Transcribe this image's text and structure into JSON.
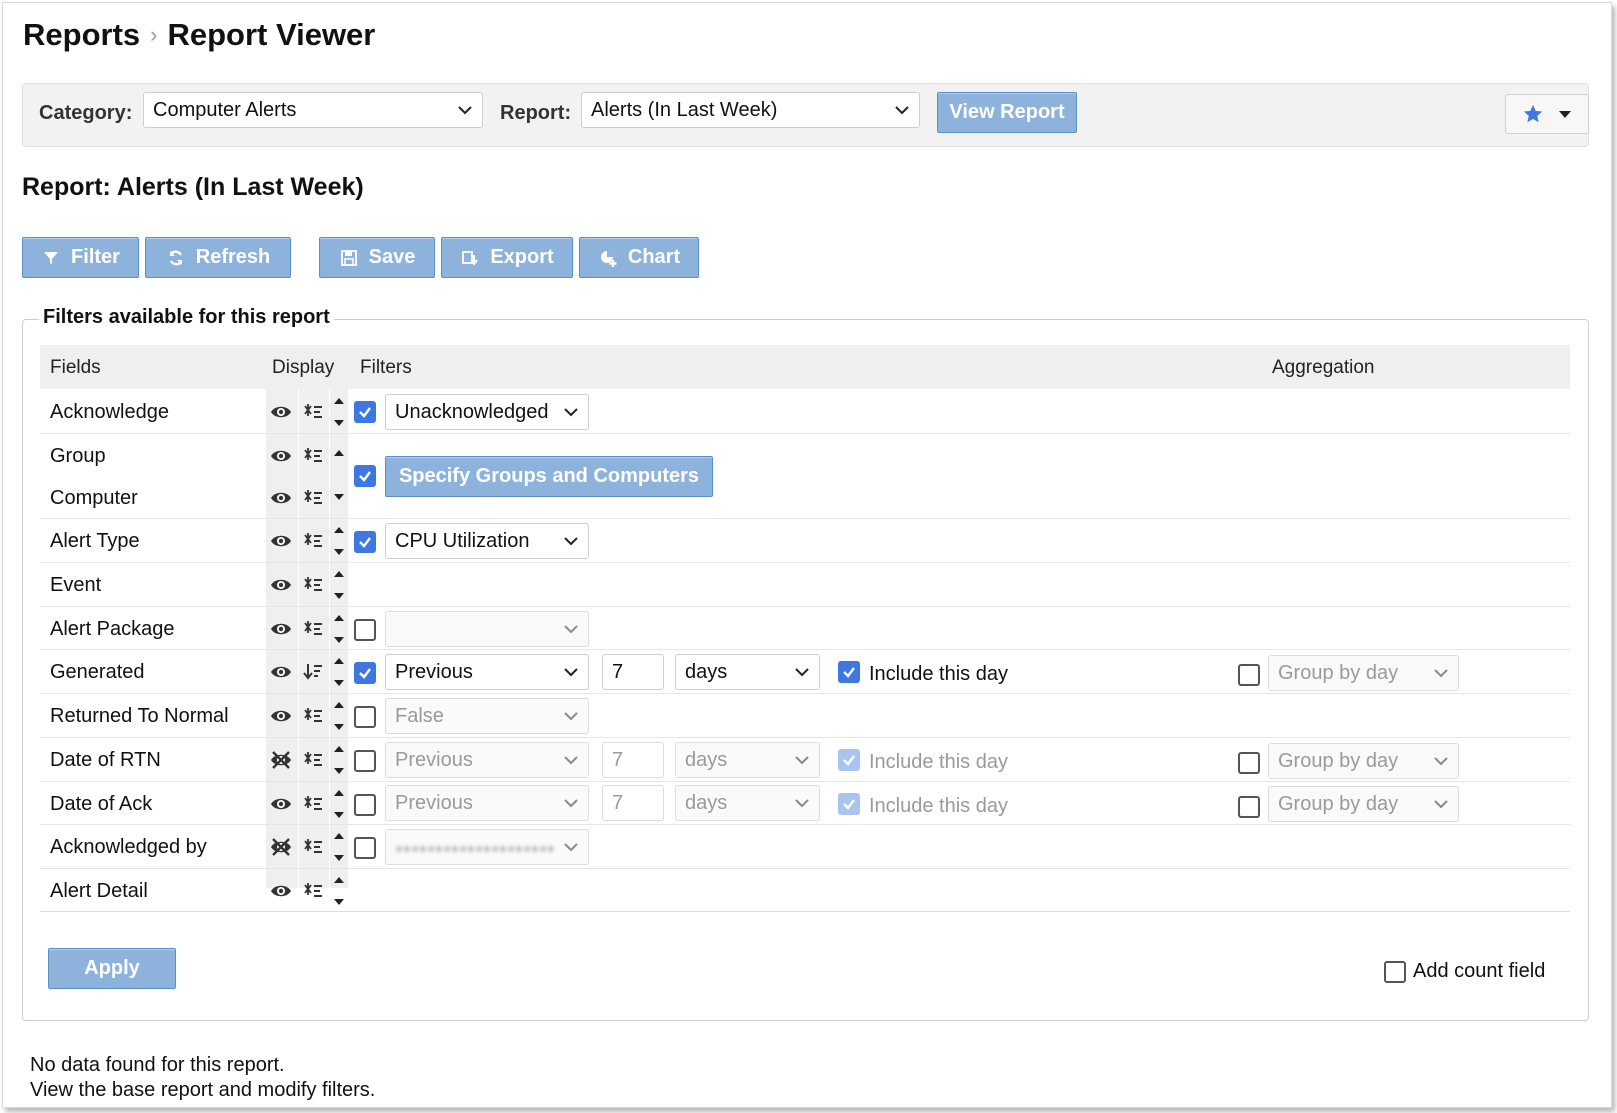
{
  "breadcrumb": {
    "parent": "Reports",
    "separator": "›",
    "current": "Report Viewer"
  },
  "toolbar": {
    "category_label": "Category:",
    "category_value": "Computer Alerts",
    "report_label": "Report:",
    "report_value": "Alerts (In Last Week)",
    "view_report_label": "View Report",
    "favorite_icon": "star-icon",
    "accent_color": "#8db3dd"
  },
  "report": {
    "title": "Report: Alerts (In Last Week)",
    "actions": {
      "filter": "Filter",
      "refresh": "Refresh",
      "save": "Save",
      "export": "Export",
      "chart": "Chart"
    }
  },
  "filters_panel": {
    "legend": "Filters available for this report",
    "columns": {
      "fields": "Fields",
      "display": "Display",
      "filters": "Filters",
      "aggregation": "Aggregation"
    },
    "rows": [
      {
        "field": "Acknowledge",
        "visible": true,
        "filter_enabled": true,
        "filter_value": "Unacknowledged"
      },
      {
        "field": "Group",
        "visible": true
      },
      {
        "field": "Computer",
        "visible": true,
        "filter_enabled": true,
        "filter_button": "Specify Groups and Computers"
      },
      {
        "field": "Alert Type",
        "visible": true,
        "filter_enabled": true,
        "filter_value": "CPU Utilization"
      },
      {
        "field": "Event",
        "visible": true
      },
      {
        "field": "Alert Package",
        "visible": true,
        "filter_enabled": false,
        "filter_value": ""
      },
      {
        "field": "Generated",
        "visible": true,
        "filter_enabled": true,
        "range": "Previous",
        "amount": "7",
        "unit": "days",
        "include_day": true,
        "include_label": "Include this day",
        "aggregate": false,
        "aggregation": "Group by day"
      },
      {
        "field": "Returned To Normal",
        "visible": true,
        "filter_enabled": false,
        "filter_value": "False"
      },
      {
        "field": "Date of RTN",
        "visible": false,
        "filter_enabled": false,
        "range": "Previous",
        "amount": "7",
        "unit": "days",
        "include_day": true,
        "include_label": "Include this day",
        "aggregate": false,
        "aggregation": "Group by day"
      },
      {
        "field": "Date of Ack",
        "visible": true,
        "filter_enabled": false,
        "range": "Previous",
        "amount": "7",
        "unit": "days",
        "include_day": true,
        "include_label": "Include this day",
        "aggregate": false,
        "aggregation": "Group by day"
      },
      {
        "field": "Acknowledged by",
        "visible": false,
        "filter_enabled": false
      },
      {
        "field": "Alert Detail",
        "visible": true
      }
    ],
    "apply_label": "Apply",
    "add_count_label": "Add count field",
    "add_count_checked": false
  },
  "messages": {
    "no_data": "No data found for this report.",
    "hint": "View the base report and modify filters."
  }
}
